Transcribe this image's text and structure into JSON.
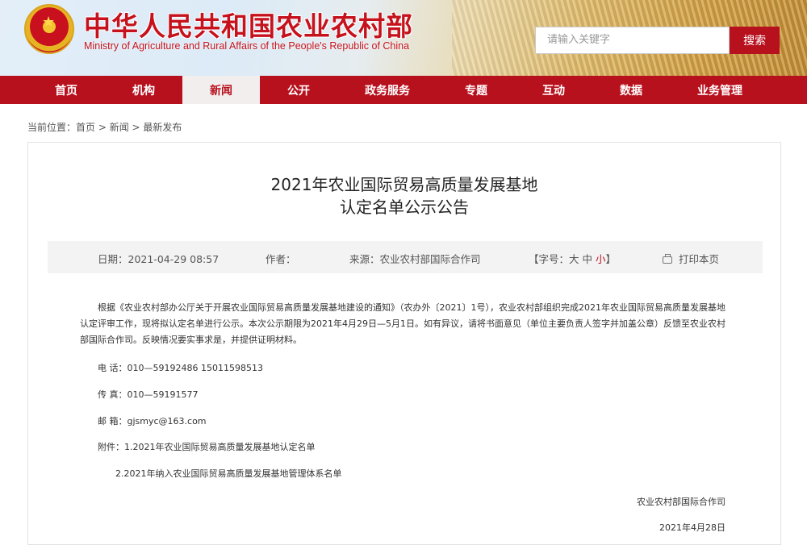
{
  "header": {
    "title_cn": "中华人民共和国农业农村部",
    "title_en": "Ministry of Agriculture and Rural Affairs of the People's Republic of China",
    "search_placeholder": "请输入关键字",
    "search_button": "搜索"
  },
  "nav": {
    "items": [
      {
        "label": "首页"
      },
      {
        "label": "机构"
      },
      {
        "label": "新闻"
      },
      {
        "label": "公开"
      },
      {
        "label": "政务服务"
      },
      {
        "label": "专题"
      },
      {
        "label": "互动"
      },
      {
        "label": "数据"
      },
      {
        "label": "业务管理"
      }
    ],
    "active_index": 2
  },
  "breadcrumb": {
    "prefix": "当前位置：",
    "items": [
      "首页",
      "新闻",
      "最新发布"
    ],
    "separator": " > "
  },
  "article": {
    "title_line1": "2021年农业国际贸易高质量发展基地",
    "title_line2": "认定名单公示公告",
    "meta": {
      "date": "日期：2021-04-29 08:57",
      "author": "作者：",
      "source": "来源：农业农村部国际合作司",
      "font_size_prefix": "【字号：",
      "size_large": "大",
      "size_medium": "中",
      "size_small": "小",
      "font_size_suffix": "】",
      "print": "打印本页"
    },
    "paragraph": "根据《农业农村部办公厅关于开展农业国际贸易高质量发展基地建设的通知》（农办外〔2021〕1号），农业农村部组织完成2021年农业国际贸易高质量发展基地认定评审工作，现将拟认定名单进行公示。本次公示期限为2021年4月29日—5月1日。如有异议，请将书面意见（单位主要负责人签字并加盖公章）反馈至农业农村部国际合作司。反映情况要实事求是，并提供证明材料。",
    "phone": "电 话：010—59192486 15011598513",
    "fax": "传 真：010—59191577",
    "email": "邮 箱：gjsmyc@163.com",
    "attachment1": "附件：1.2021年农业国际贸易高质量发展基地认定名单",
    "attachment2": "2.2021年纳入农业国际贸易高质量发展基地管理体系名单",
    "signature": "农业农村部国际合作司",
    "sign_date": "2021年4月28日"
  },
  "colors": {
    "brand_red": "#b8111e",
    "nav_active_bg": "#f3eeee",
    "meta_bg": "#f3f3f3"
  }
}
